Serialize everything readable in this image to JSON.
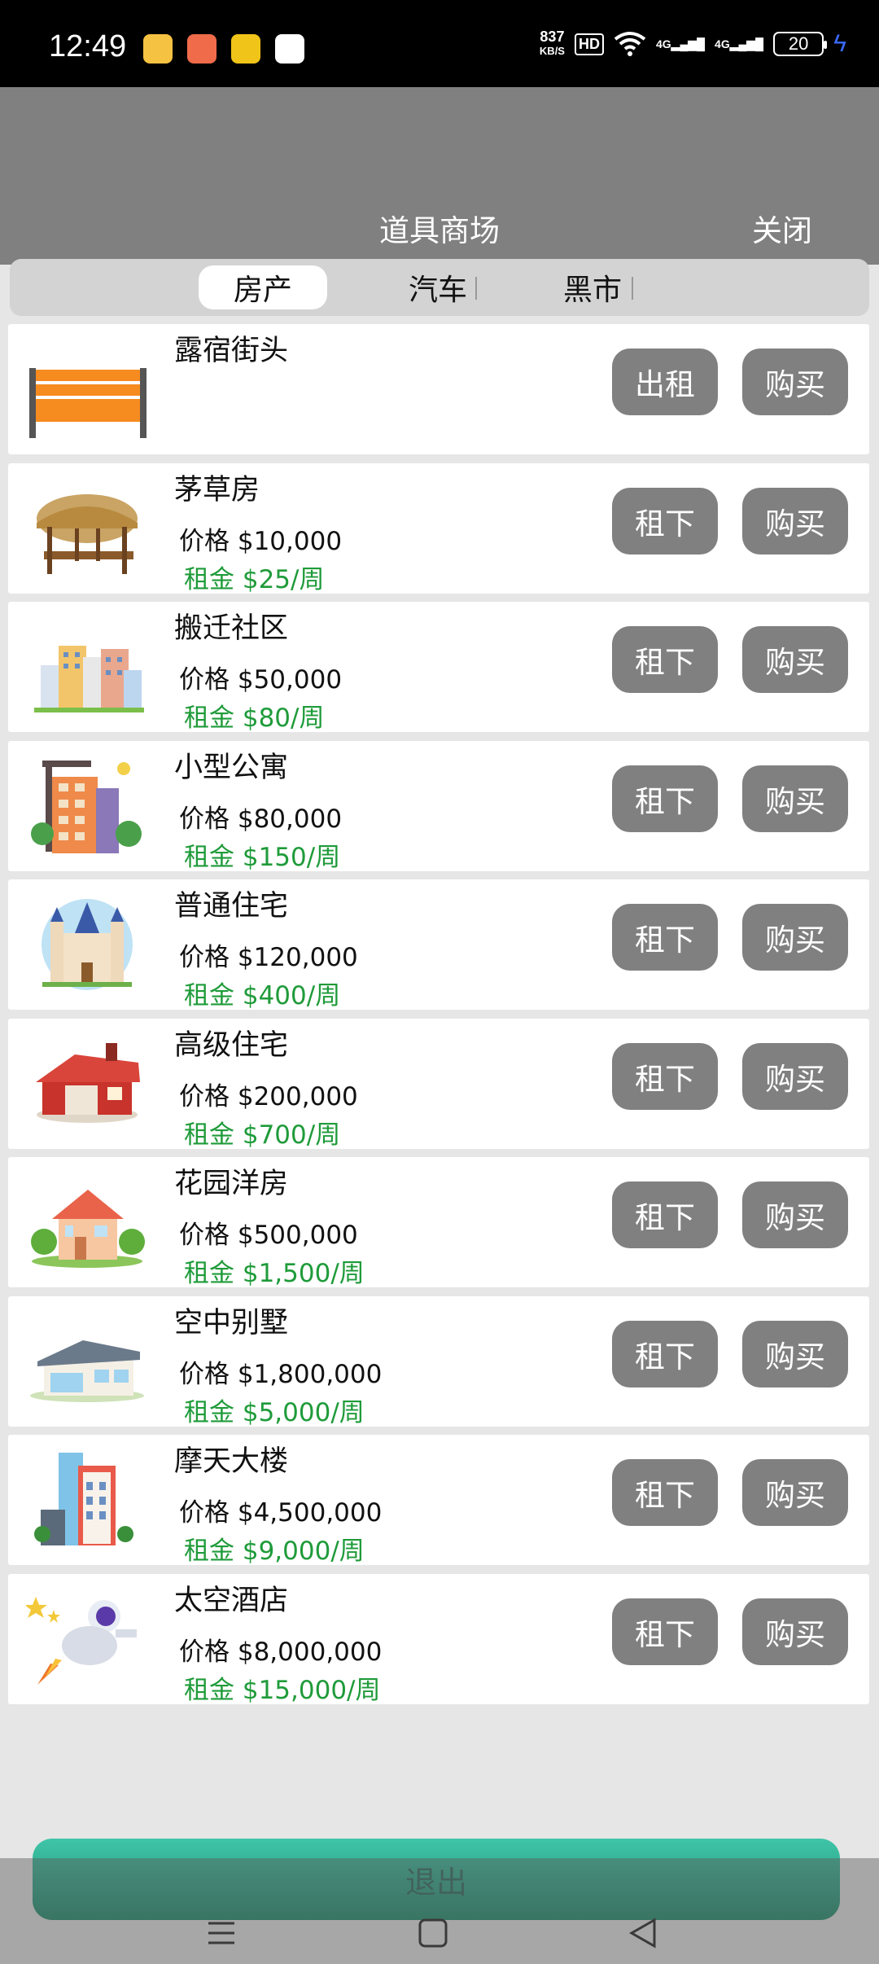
{
  "status_bar": {
    "time": "12:49",
    "net_speed_value": "837",
    "net_speed_unit": "KB/S",
    "hd_label": "HD",
    "signal_1": "4G",
    "signal_2": "4G",
    "battery": "20"
  },
  "header": {
    "title": "道具商场",
    "close_label": "关闭"
  },
  "tabs": [
    {
      "label": "房产",
      "active": true
    },
    {
      "label": "汽车",
      "active": false
    },
    {
      "label": "黑市",
      "active": false
    }
  ],
  "items": [
    {
      "icon": "bench-icon",
      "name": "露宿街头",
      "price": "",
      "rent": "",
      "rent_button": "出租",
      "buy_button": "购买"
    },
    {
      "icon": "thatched-hut-icon",
      "name": "茅草房",
      "price": "价格 $10,000",
      "rent": "租金 $25/周",
      "rent_button": "租下",
      "buy_button": "购买"
    },
    {
      "icon": "community-buildings-icon",
      "name": "搬迁社区",
      "price": "价格 $50,000",
      "rent": "租金 $80/周",
      "rent_button": "租下",
      "buy_button": "购买"
    },
    {
      "icon": "apartment-icon",
      "name": "小型公寓",
      "price": "价格 $80,000",
      "rent": "租金 $150/周",
      "rent_button": "租下",
      "buy_button": "购买"
    },
    {
      "icon": "castle-house-icon",
      "name": "普通住宅",
      "price": "价格 $120,000",
      "rent": "租金 $400/周",
      "rent_button": "租下",
      "buy_button": "购买"
    },
    {
      "icon": "red-house-icon",
      "name": "高级住宅",
      "price": "价格 $200,000",
      "rent": "租金 $700/周",
      "rent_button": "租下",
      "buy_button": "购买"
    },
    {
      "icon": "garden-house-icon",
      "name": "花园洋房",
      "price": "价格 $500,000",
      "rent": "租金 $1,500/周",
      "rent_button": "租下",
      "buy_button": "购买"
    },
    {
      "icon": "villa-icon",
      "name": "空中别墅",
      "price": "价格 $1,800,000",
      "rent": "租金 $5,000/周",
      "rent_button": "租下",
      "buy_button": "购买"
    },
    {
      "icon": "skyscraper-icon",
      "name": "摩天大楼",
      "price": "价格 $4,500,000",
      "rent": "租金 $9,000/周",
      "rent_button": "租下",
      "buy_button": "购买"
    },
    {
      "icon": "astronaut-icon",
      "name": "太空酒店",
      "price": "价格 $8,000,000",
      "rent": "租金 $15,000/周",
      "rent_button": "租下",
      "buy_button": "购买"
    }
  ],
  "exit_label": "退出",
  "colors": {
    "header_bg": "#808080",
    "button_bg": "#808080",
    "rent_text": "#1f9b3a",
    "exit_top": "#3fc5a9",
    "exit_bottom": "#1f8a6a"
  }
}
